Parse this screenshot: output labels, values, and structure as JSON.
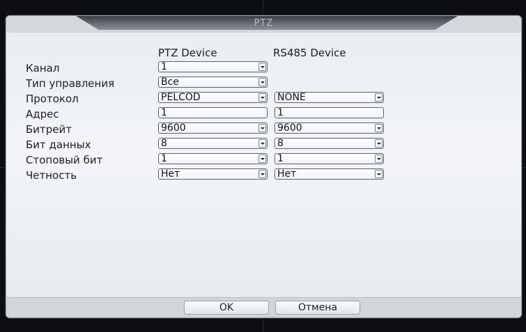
{
  "dialog": {
    "title": "PTZ",
    "columns": {
      "ptz": "PTZ Device",
      "rs485": "RS485 Device"
    },
    "rows": [
      {
        "label": "Канал",
        "ptz": "1"
      },
      {
        "label": "Тип управления",
        "ptz": "Все"
      },
      {
        "label": "Протокол",
        "ptz": "PELCOD",
        "rs485": "NONE"
      },
      {
        "label": "Адрес",
        "ptz": "1",
        "rs485": "1"
      },
      {
        "label": "Битрейт",
        "ptz": "9600",
        "rs485": "9600"
      },
      {
        "label": "Бит данных",
        "ptz": "8",
        "rs485": "8"
      },
      {
        "label": "Стоповый бит",
        "ptz": "1",
        "rs485": "1"
      },
      {
        "label": "Четность",
        "ptz": "Нет",
        "rs485": "Нет"
      }
    ],
    "buttons": {
      "ok": "OK",
      "cancel": "Отмена"
    }
  }
}
